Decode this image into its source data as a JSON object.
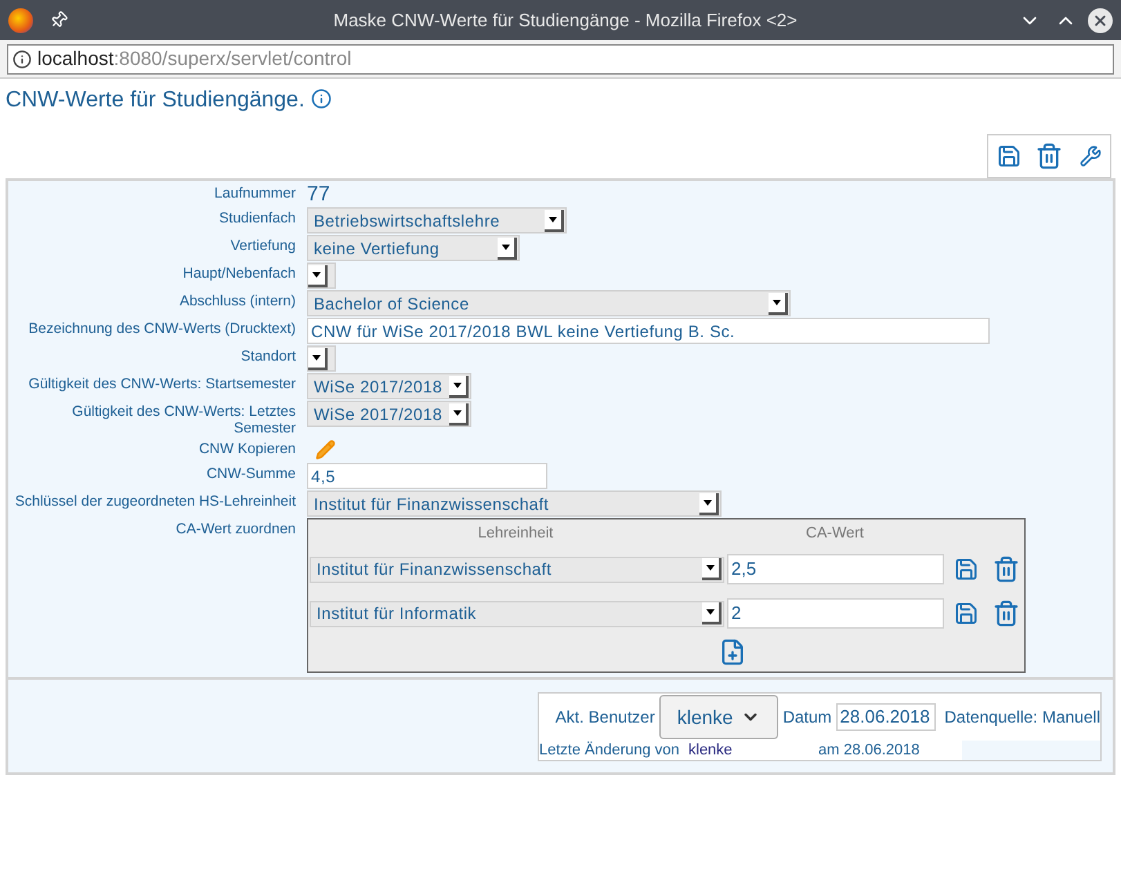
{
  "window": {
    "title": "Maske CNW-Werte für Studiengänge - Mozilla Firefox <2>"
  },
  "address_bar": {
    "host": "localhost",
    "path": ":8080/superx/servlet/control"
  },
  "page_title": "CNW-Werte für Studiengänge.",
  "fields": [
    {
      "label": "Laufnummer",
      "kind": "text",
      "value": "77"
    },
    {
      "label": "Studienfach",
      "kind": "select",
      "value": "Betriebswirtschaftslehre"
    },
    {
      "label": "Vertiefung",
      "kind": "select",
      "value": "keine Vertiefung"
    },
    {
      "label": "Haupt/Nebenfach",
      "kind": "select"
    },
    {
      "label": "Abschluss (intern)",
      "kind": "select",
      "value": "Bachelor of Science"
    },
    {
      "label": "Bezeichnung des CNW-Werts (Drucktext)",
      "kind": "input",
      "value": "CNW für WiSe 2017/2018 BWL keine Vertiefung B. Sc."
    },
    {
      "label": "Standort",
      "kind": "select"
    },
    {
      "label": "Gültigkeit des CNW-Werts: Startsemester",
      "kind": "select",
      "value": "WiSe 2017/2018"
    },
    {
      "label": "Gültigkeit des CNW-Werts: Letztes Semester",
      "kind": "select",
      "value": "WiSe 2017/2018"
    },
    {
      "label": "CNW Kopieren",
      "kind": "pencil"
    },
    {
      "label": "CNW-Summe",
      "kind": "input",
      "value": "4,5"
    },
    {
      "label": "Schlüssel der zugeordneten HS-Lehreinheit",
      "kind": "select",
      "value": "Institut für Finanzwissenschaft"
    },
    {
      "label": "CA-Wert zuordnen",
      "kind": "table"
    }
  ],
  "ca_table": {
    "columns": [
      "Lehreinheit",
      "CA-Wert"
    ],
    "rows": [
      {
        "unit": "Institut für Finanzwissenschaft",
        "value": "2,5"
      },
      {
        "unit": "Institut für Informatik",
        "value": "2"
      }
    ]
  },
  "footer": {
    "user_label": "Akt. Benutzer",
    "user": "klenke",
    "date_label": "Datum",
    "date": "28.06.2018",
    "source": "Datenquelle: Manuell",
    "changed_label": "Letzte Änderung von",
    "changed_by": "klenke",
    "changed_on": "am 28.06.2018"
  }
}
